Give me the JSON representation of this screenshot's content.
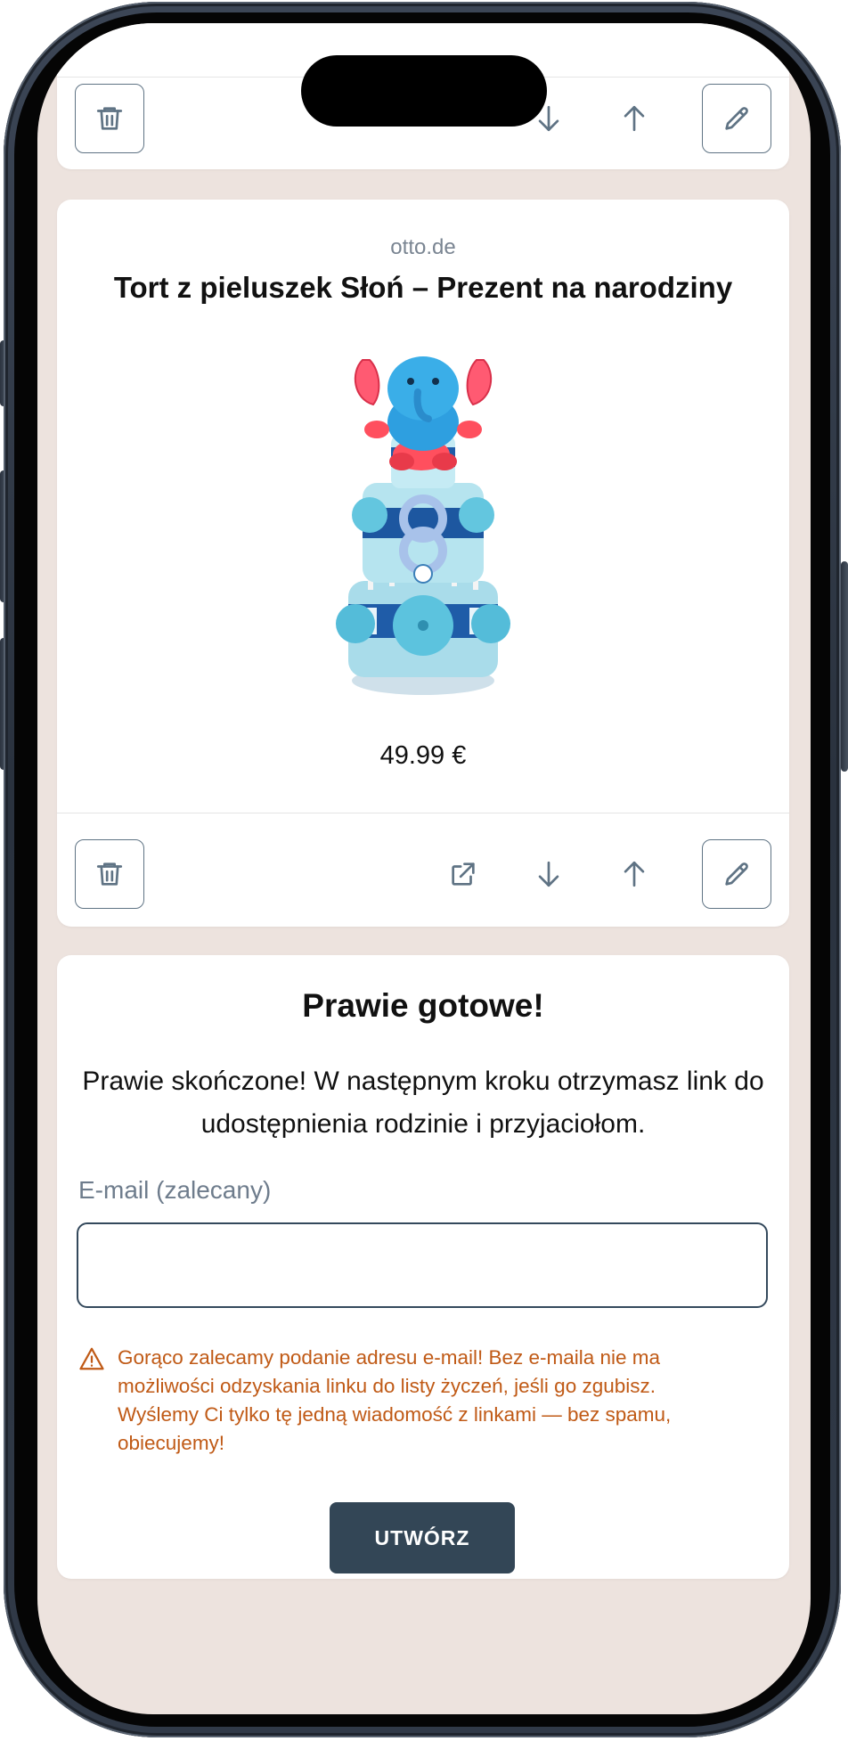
{
  "top_card": {
    "actions": {
      "delete_icon": "trash-icon",
      "move_down_icon": "arrow-down-icon",
      "move_up_icon": "arrow-up-icon",
      "edit_icon": "pencil-icon"
    }
  },
  "product": {
    "source": "otto.de",
    "title": "Tort z pieluszek Słoń – Prezent na narodziny",
    "price": "49.99 €",
    "actions": {
      "delete_icon": "trash-icon",
      "open_link_icon": "external-link-icon",
      "move_down_icon": "arrow-down-icon",
      "move_up_icon": "arrow-up-icon",
      "edit_icon": "pencil-icon"
    }
  },
  "form": {
    "heading": "Prawie gotowe!",
    "description": "Prawie skończone! W następnym kroku otrzymasz link do udostępnienia rodzinie i przyjaciołom.",
    "email_label": "E-mail (zalecany)",
    "email_value": "",
    "email_placeholder": "",
    "warning": "Gorąco zalecamy podanie adresu e-mail! Bez e-maila nie ma możliwości odzyskania linku do listy życzeń, jeśli go zgubisz. Wyślemy Ci tylko tę jedną wiadomość z linkami — bez spamu, obiecujemy!",
    "submit_label": "UTWÓRZ"
  },
  "colors": {
    "background": "#ede3de",
    "card": "#ffffff",
    "icon": "#5f7384",
    "primary_button": "#334656",
    "warning_text": "#c05a16"
  }
}
